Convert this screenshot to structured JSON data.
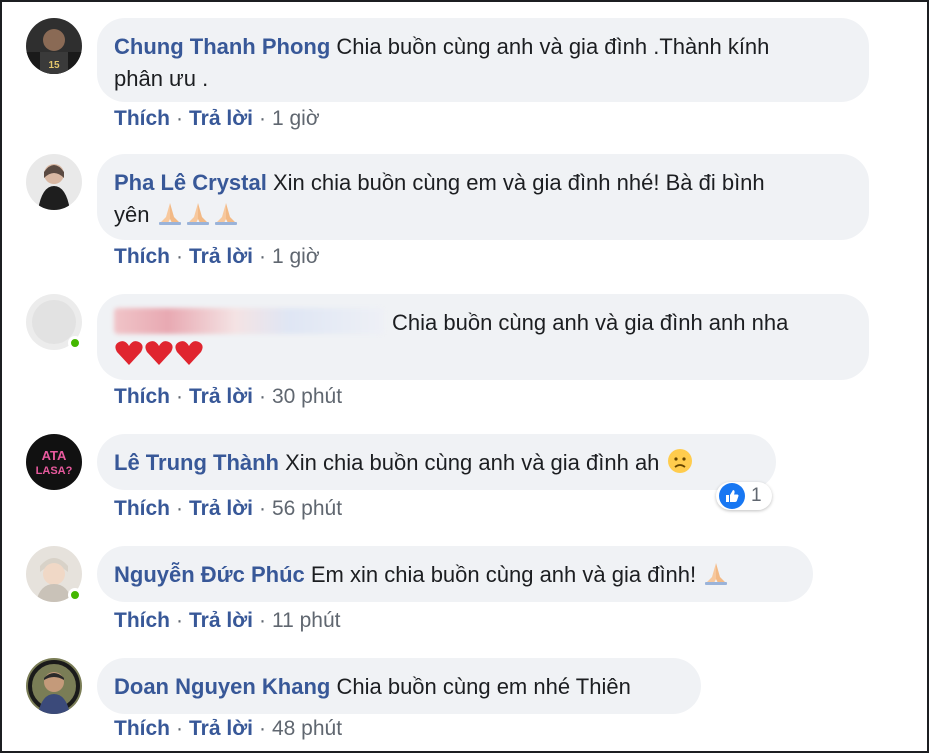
{
  "comments": [
    {
      "author": "Chung Thanh Phong",
      "text": "Chia buồn cùng anh và gia đình .Thành kính",
      "text2": "phân ưu .",
      "actions": {
        "like": "Thích",
        "reply": "Trả lời",
        "time": "1 giờ"
      },
      "avatar_color": "#2b2b2b"
    },
    {
      "author": "Pha Lê Crystal",
      "text": "Xin chia buồn cùng em và gia đình nhé! Bà đi bình",
      "text2": "yên",
      "emoji": [
        "folded-hands-icon",
        "folded-hands-icon",
        "folded-hands-icon"
      ],
      "actions": {
        "like": "Thích",
        "reply": "Trả lời",
        "time": "1 giờ"
      },
      "avatar_color": "#bdbdbd"
    },
    {
      "author": "",
      "text": "Chia buồn cùng anh và gia đình anh nha",
      "emoji": [
        "red-heart-icon",
        "red-heart-icon",
        "red-heart-icon"
      ],
      "actions": {
        "like": "Thích",
        "reply": "Trả lời",
        "time": "30 phút"
      },
      "avatar_color": "#e8e8e8"
    },
    {
      "author": "Lê Trung Thành",
      "text": "Xin chia buồn cùng anh và gia đình ah",
      "emoji": [
        "sad-face-icon"
      ],
      "reaction": {
        "icon": "like-icon",
        "count": "1"
      },
      "actions": {
        "like": "Thích",
        "reply": "Trả lời",
        "time": "56 phút"
      },
      "avatar_color": "#111111",
      "avatar_text": "ATA LASA?"
    },
    {
      "author": "Nguyễn Đức Phúc",
      "text": "Em xin chia buồn cùng anh và gia đình!",
      "emoji": [
        "folded-hands-icon"
      ],
      "actions": {
        "like": "Thích",
        "reply": "Trả lời",
        "time": "11 phút"
      },
      "avatar_color": "#d9d3cc"
    },
    {
      "author": "Doan Nguyen Khang",
      "text": "Chia buồn cùng em nhé Thiên",
      "actions": {
        "like": "Thích",
        "reply": "Trả lời",
        "time": "48 phút"
      },
      "avatar_color": "#6b6f4a"
    }
  ],
  "colors": {
    "author_link": "#385898",
    "bubble_bg": "#f0f2f5",
    "online": "#44b700",
    "like_blue": "#1877f2"
  }
}
